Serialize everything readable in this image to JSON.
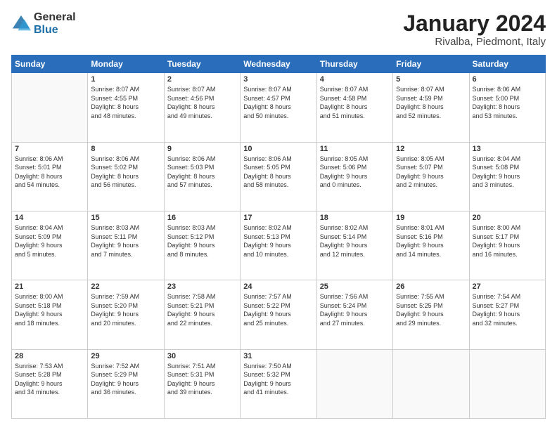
{
  "logo": {
    "general": "General",
    "blue": "Blue"
  },
  "title": "January 2024",
  "location": "Rivalba, Piedmont, Italy",
  "days_header": [
    "Sunday",
    "Monday",
    "Tuesday",
    "Wednesday",
    "Thursday",
    "Friday",
    "Saturday"
  ],
  "weeks": [
    [
      {
        "day": "",
        "info": ""
      },
      {
        "day": "1",
        "info": "Sunrise: 8:07 AM\nSunset: 4:55 PM\nDaylight: 8 hours\nand 48 minutes."
      },
      {
        "day": "2",
        "info": "Sunrise: 8:07 AM\nSunset: 4:56 PM\nDaylight: 8 hours\nand 49 minutes."
      },
      {
        "day": "3",
        "info": "Sunrise: 8:07 AM\nSunset: 4:57 PM\nDaylight: 8 hours\nand 50 minutes."
      },
      {
        "day": "4",
        "info": "Sunrise: 8:07 AM\nSunset: 4:58 PM\nDaylight: 8 hours\nand 51 minutes."
      },
      {
        "day": "5",
        "info": "Sunrise: 8:07 AM\nSunset: 4:59 PM\nDaylight: 8 hours\nand 52 minutes."
      },
      {
        "day": "6",
        "info": "Sunrise: 8:06 AM\nSunset: 5:00 PM\nDaylight: 8 hours\nand 53 minutes."
      }
    ],
    [
      {
        "day": "7",
        "info": "Sunrise: 8:06 AM\nSunset: 5:01 PM\nDaylight: 8 hours\nand 54 minutes."
      },
      {
        "day": "8",
        "info": "Sunrise: 8:06 AM\nSunset: 5:02 PM\nDaylight: 8 hours\nand 56 minutes."
      },
      {
        "day": "9",
        "info": "Sunrise: 8:06 AM\nSunset: 5:03 PM\nDaylight: 8 hours\nand 57 minutes."
      },
      {
        "day": "10",
        "info": "Sunrise: 8:06 AM\nSunset: 5:05 PM\nDaylight: 8 hours\nand 58 minutes."
      },
      {
        "day": "11",
        "info": "Sunrise: 8:05 AM\nSunset: 5:06 PM\nDaylight: 9 hours\nand 0 minutes."
      },
      {
        "day": "12",
        "info": "Sunrise: 8:05 AM\nSunset: 5:07 PM\nDaylight: 9 hours\nand 2 minutes."
      },
      {
        "day": "13",
        "info": "Sunrise: 8:04 AM\nSunset: 5:08 PM\nDaylight: 9 hours\nand 3 minutes."
      }
    ],
    [
      {
        "day": "14",
        "info": "Sunrise: 8:04 AM\nSunset: 5:09 PM\nDaylight: 9 hours\nand 5 minutes."
      },
      {
        "day": "15",
        "info": "Sunrise: 8:03 AM\nSunset: 5:11 PM\nDaylight: 9 hours\nand 7 minutes."
      },
      {
        "day": "16",
        "info": "Sunrise: 8:03 AM\nSunset: 5:12 PM\nDaylight: 9 hours\nand 8 minutes."
      },
      {
        "day": "17",
        "info": "Sunrise: 8:02 AM\nSunset: 5:13 PM\nDaylight: 9 hours\nand 10 minutes."
      },
      {
        "day": "18",
        "info": "Sunrise: 8:02 AM\nSunset: 5:14 PM\nDaylight: 9 hours\nand 12 minutes."
      },
      {
        "day": "19",
        "info": "Sunrise: 8:01 AM\nSunset: 5:16 PM\nDaylight: 9 hours\nand 14 minutes."
      },
      {
        "day": "20",
        "info": "Sunrise: 8:00 AM\nSunset: 5:17 PM\nDaylight: 9 hours\nand 16 minutes."
      }
    ],
    [
      {
        "day": "21",
        "info": "Sunrise: 8:00 AM\nSunset: 5:18 PM\nDaylight: 9 hours\nand 18 minutes."
      },
      {
        "day": "22",
        "info": "Sunrise: 7:59 AM\nSunset: 5:20 PM\nDaylight: 9 hours\nand 20 minutes."
      },
      {
        "day": "23",
        "info": "Sunrise: 7:58 AM\nSunset: 5:21 PM\nDaylight: 9 hours\nand 22 minutes."
      },
      {
        "day": "24",
        "info": "Sunrise: 7:57 AM\nSunset: 5:22 PM\nDaylight: 9 hours\nand 25 minutes."
      },
      {
        "day": "25",
        "info": "Sunrise: 7:56 AM\nSunset: 5:24 PM\nDaylight: 9 hours\nand 27 minutes."
      },
      {
        "day": "26",
        "info": "Sunrise: 7:55 AM\nSunset: 5:25 PM\nDaylight: 9 hours\nand 29 minutes."
      },
      {
        "day": "27",
        "info": "Sunrise: 7:54 AM\nSunset: 5:27 PM\nDaylight: 9 hours\nand 32 minutes."
      }
    ],
    [
      {
        "day": "28",
        "info": "Sunrise: 7:53 AM\nSunset: 5:28 PM\nDaylight: 9 hours\nand 34 minutes."
      },
      {
        "day": "29",
        "info": "Sunrise: 7:52 AM\nSunset: 5:29 PM\nDaylight: 9 hours\nand 36 minutes."
      },
      {
        "day": "30",
        "info": "Sunrise: 7:51 AM\nSunset: 5:31 PM\nDaylight: 9 hours\nand 39 minutes."
      },
      {
        "day": "31",
        "info": "Sunrise: 7:50 AM\nSunset: 5:32 PM\nDaylight: 9 hours\nand 41 minutes."
      },
      {
        "day": "",
        "info": ""
      },
      {
        "day": "",
        "info": ""
      },
      {
        "day": "",
        "info": ""
      }
    ]
  ]
}
